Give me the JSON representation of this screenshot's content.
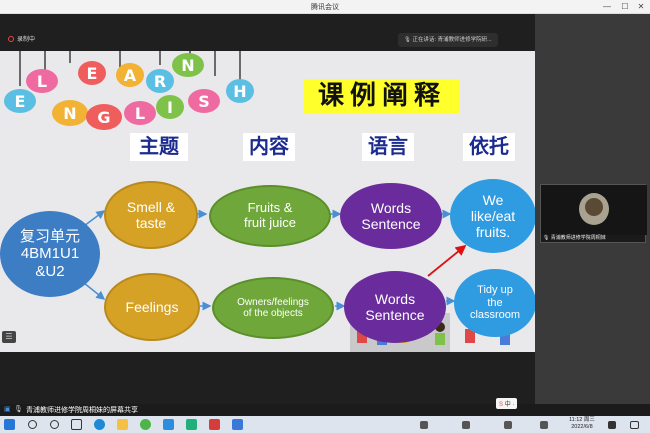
{
  "window": {
    "title": "腾讯会议",
    "min": "—",
    "max": "☐",
    "close": "✕"
  },
  "meeting": {
    "recording": "录制中",
    "speaking": "正在讲话: 青浦教师进修学院研..."
  },
  "slide": {
    "banner_letters": [
      "L",
      "E",
      "A",
      "R",
      "N",
      "E",
      "N",
      "G",
      "L",
      "I",
      "S",
      "H"
    ],
    "title": "课例阐释",
    "headers": [
      "主题",
      "内容",
      "语言",
      "依托"
    ],
    "nodes": {
      "unit": "复习单元\n4BM1U1\n&U2",
      "smell": "Smell &\ntaste",
      "feelings": "Feelings",
      "fruits": "Fruits &\nfruit juice",
      "owners": "Owners/feelings\nof the objects",
      "words1": "Words\nSentence",
      "words2": "Words\nSentence",
      "welike": "We\nlike/eat\nfruits.",
      "tidy": "Tidy up\nthe\nclassroom"
    }
  },
  "participant": {
    "name": "青浦教师进修学院周桐妹"
  },
  "share_bar": {
    "label": "青浦教师进修学院周桐妹的屏幕共享"
  },
  "taskbar": {
    "time": "11:12 周三",
    "date": "2022/6/8",
    "ime": "中 ·"
  }
}
